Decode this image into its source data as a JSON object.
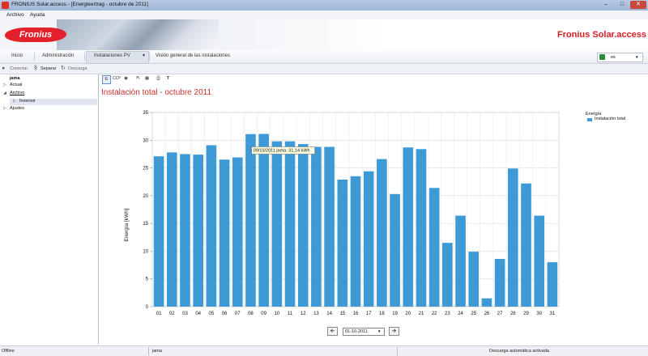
{
  "window": {
    "title": "FRONIUS Solar.access - [Energieertrag - octubre de 2011]",
    "controls": [
      "minimize-icon",
      "maximize-icon",
      "close-icon"
    ]
  },
  "menu": {
    "items": [
      "Archivo",
      "Ayuda"
    ]
  },
  "banner": {
    "logo_text": "Fronius",
    "app_title": "Fronius Solar.access",
    "brand_color": "#d41f26"
  },
  "nav": {
    "tabs": [
      "Inicio",
      "Administración",
      "Instalaciones PV",
      "Visión general de las instalaciones"
    ],
    "active_tab": "Instalaciones PV",
    "language": "es"
  },
  "toolbar": {
    "connect": "Conectar",
    "separate": "Separar",
    "download": "Descarga"
  },
  "sidebar": {
    "items": [
      {
        "label": "jama",
        "level": 0,
        "bold": true
      },
      {
        "label": "Actual",
        "level": 0
      },
      {
        "label": "Archivo",
        "level": 0,
        "underline": true,
        "expanded": true
      },
      {
        "label": "Inversor",
        "level": 1,
        "selected": true
      },
      {
        "label": "Ajustes",
        "level": 0
      }
    ]
  },
  "chart_toolbar": {
    "e_label": "E",
    "co2_label": "CO²",
    "t_label": "T"
  },
  "chart_data": {
    "type": "bar",
    "title": "Instalación total - octubre 2011",
    "ylabel": "Energía [kWh]",
    "xlabel": "",
    "ylim": [
      0,
      35
    ],
    "yticks": [
      "0",
      "5",
      "10",
      "15",
      "20",
      "25",
      "30",
      "35"
    ],
    "categories": [
      "01",
      "02",
      "03",
      "04",
      "05",
      "06",
      "07",
      "08",
      "09",
      "10",
      "11",
      "12",
      "13",
      "14",
      "15",
      "16",
      "17",
      "18",
      "19",
      "20",
      "21",
      "22",
      "23",
      "24",
      "25",
      "26",
      "27",
      "28",
      "29",
      "30",
      "31"
    ],
    "series": [
      {
        "name": "Instalación total",
        "values": [
          27.1,
          27.8,
          27.5,
          27.4,
          29.1,
          26.5,
          26.9,
          31.1,
          31.14,
          29.8,
          29.8,
          29.3,
          28.8,
          28.8,
          22.9,
          23.5,
          24.4,
          26.6,
          20.3,
          28.7,
          28.4,
          21.4,
          11.5,
          16.4,
          9.9,
          1.5,
          8.6,
          24.9,
          22.2,
          16.4,
          8.0
        ]
      }
    ],
    "legend": {
      "title": "Energía",
      "position": "top-right"
    },
    "grid": true,
    "bar_color": "#3d9ad6",
    "tooltip": {
      "text": "09/10/2011 jama: 31,14 kWh",
      "index": 8
    }
  },
  "date_nav": {
    "date": "01-10-2011"
  },
  "status": {
    "connection": "Offline",
    "plant": "jama",
    "message": "Descarga automática activada"
  }
}
